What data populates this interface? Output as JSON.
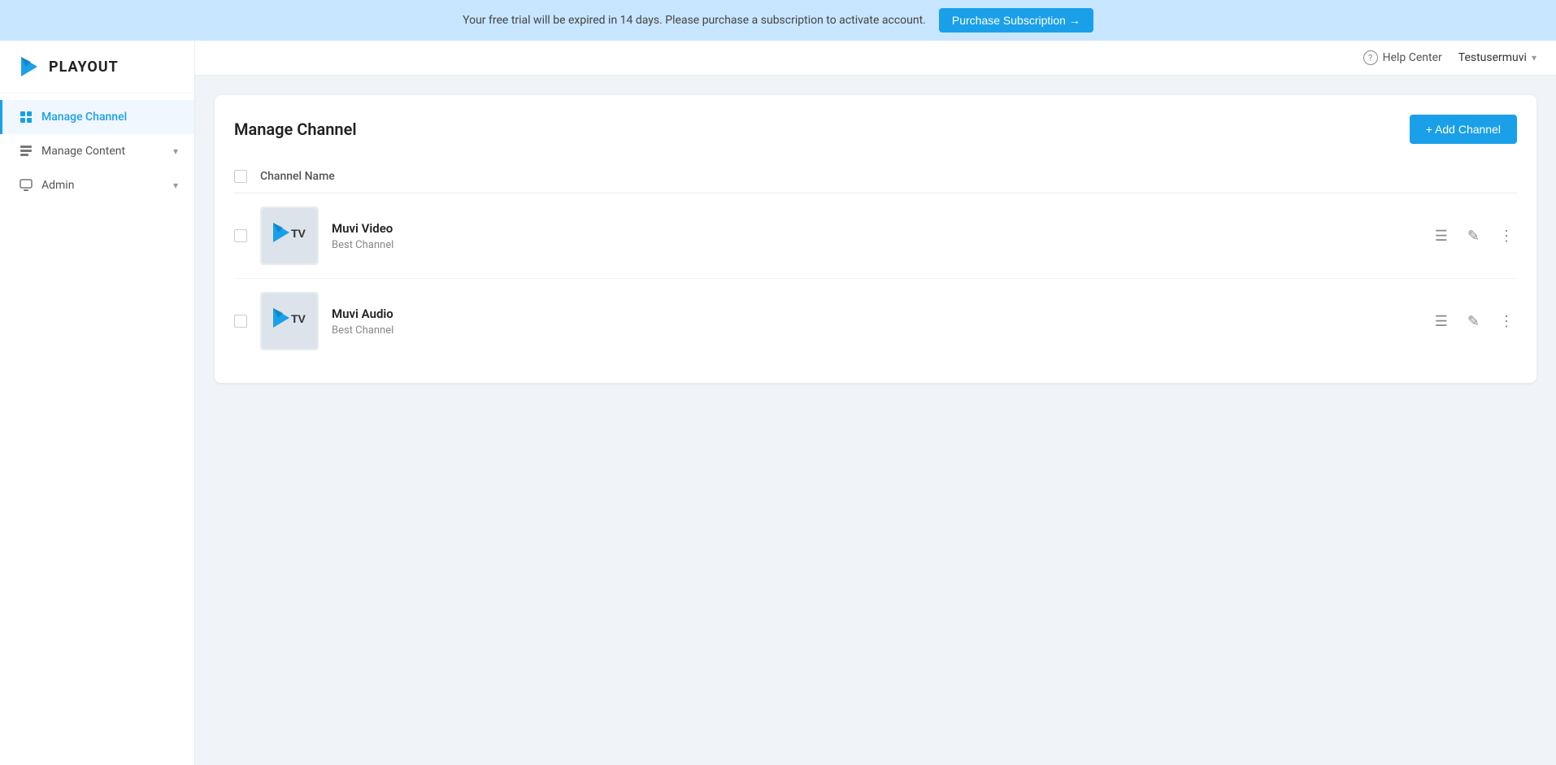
{
  "banner": {
    "text": "Your free trial will be expired in 14 days. Please purchase a subscription to activate account.",
    "purchase_btn_label": "Purchase Subscription →"
  },
  "logo": {
    "text": "PLAYOUT"
  },
  "sidebar": {
    "items": [
      {
        "id": "manage-channel",
        "label": "Manage Channel",
        "active": true,
        "has_chevron": false
      },
      {
        "id": "manage-content",
        "label": "Manage Content",
        "active": false,
        "has_chevron": true
      },
      {
        "id": "admin",
        "label": "Admin",
        "active": false,
        "has_chevron": true
      }
    ]
  },
  "topbar": {
    "help_center_label": "Help Center",
    "user_label": "Testusermuvi"
  },
  "main": {
    "page_title": "Manage Channel",
    "add_channel_label": "+ Add Channel",
    "table": {
      "column_name": "Channel Name",
      "channels": [
        {
          "name": "Muvi Video",
          "description": "Best Channel"
        },
        {
          "name": "Muvi Audio",
          "description": "Best Channel"
        }
      ]
    }
  }
}
